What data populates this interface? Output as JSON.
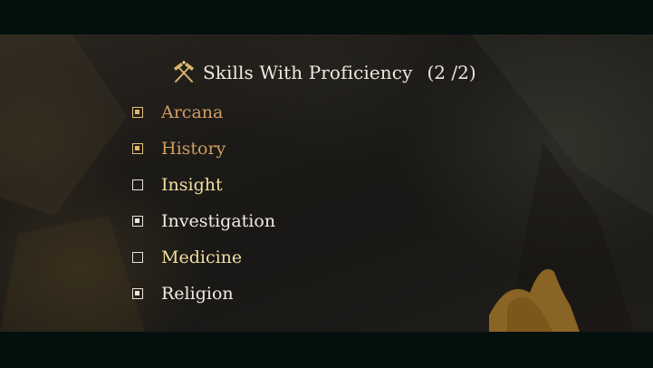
{
  "header": {
    "title": "Skills With Proficiency",
    "count": "(2 /2)",
    "icon": "crossed-hammers-icon"
  },
  "skills": [
    {
      "label": "Arcana",
      "state": "locked"
    },
    {
      "label": "History",
      "state": "locked"
    },
    {
      "label": "Insight",
      "state": "available"
    },
    {
      "label": "Investigation",
      "state": "selected"
    },
    {
      "label": "Medicine",
      "state": "available"
    },
    {
      "label": "Religion",
      "state": "selected"
    }
  ],
  "colors": {
    "locked": "#cf9d63",
    "selected": "#f1ece2",
    "available": "#f3dea0",
    "letterbox": "#04100e"
  }
}
